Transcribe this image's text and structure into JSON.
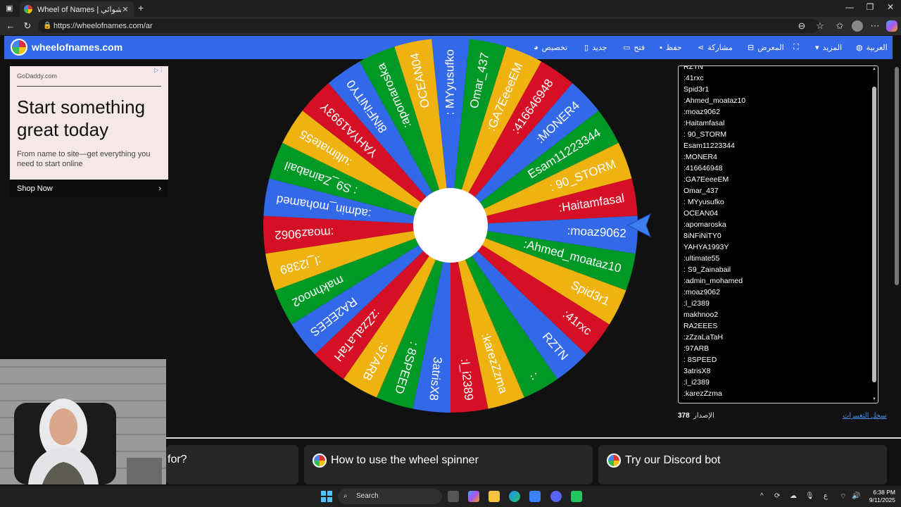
{
  "browser": {
    "tab_title": "Wheel of Names | الاسم العشوائي",
    "url": "https://wheelofnames.com/ar"
  },
  "site": {
    "brand": "wheelofnames.com",
    "menu": [
      {
        "label": "تخصيص",
        "icon": "palette-icon"
      },
      {
        "label": "جديد",
        "icon": "new-file-icon"
      },
      {
        "label": "فتح",
        "icon": "folder-icon"
      },
      {
        "label": "حفظ",
        "icon": "save-icon"
      },
      {
        "label": "مشاركة",
        "icon": "share-icon"
      },
      {
        "label": "المعرض",
        "icon": "gallery-icon"
      },
      {
        "label": "المزيد",
        "icon": "fullscreen-icon"
      },
      {
        "label": "العربية",
        "icon": "globe-icon"
      }
    ],
    "header_color": "#3369e8"
  },
  "ad": {
    "domain": "GoDaddy.com",
    "headline": "Start something great today",
    "subtext": "From name to site—get everything you need to start online",
    "cta": "Shop Now"
  },
  "wheel": {
    "colors": [
      "#3369e8",
      "#009925",
      "#eeb211",
      "#d50f25"
    ],
    "slices": [
      ": MYyusufko",
      "Omar_437",
      ":GA7EeeeEM",
      ":416646948",
      ":MONER4",
      "Esam11223344",
      ": 90_STORM",
      ":Haitamfasal",
      ":moaz9062",
      ":Ahmed_moataz10",
      "Spid3r1",
      ":41rxc",
      "RZTN",
      ":.",
      ":karezZzma",
      ":l_i2389",
      "3atrisX8",
      ": 8SPEED",
      ":97ARB",
      ":zZzaLaTaH",
      "RA2EEES",
      "makhnoo2",
      ":l_i2389",
      ":moaz9062",
      ":admin_mohamed",
      ": S9_Zainabail",
      ":ultimate55",
      "YAHYA1993Y",
      "8iNFiNiTY0",
      ":apomaroska",
      "OCEAN04"
    ]
  },
  "entries": [
    "RZTN",
    ":41rxc",
    "Spid3r1",
    ":Ahmed_moataz10",
    ":moaz9062",
    ":Haitamfasal",
    ": 90_STORM",
    "Esam11223344",
    ":MONER4",
    ":416646948",
    ":GA7EeeeEM",
    "Omar_437",
    ": MYyusufko",
    "OCEAN04",
    ":apomaroska",
    "8iNFiNiTY0",
    "YAHYA1993Y",
    ":ultimate55",
    ": S9_Zainabail",
    ":admin_mohamed",
    ":moaz9062",
    ":l_i2389",
    "makhnoo2",
    "RA2EEES",
    ":zZzaLaTaH",
    ":97ARB",
    ": 8SPEED",
    "3atrisX8",
    ":l_i2389",
    ":karezZzma"
  ],
  "version": {
    "label": "الإصدار",
    "number": "378"
  },
  "changelog_label": "سجل التغييرات",
  "cards": [
    {
      "title": "for?"
    },
    {
      "title": "How to use the wheel spinner"
    },
    {
      "title": "Try our Discord bot"
    }
  ],
  "taskbar": {
    "search": "Search",
    "time": "6:38 PM",
    "date": "9/11/2025",
    "lang": "ع"
  }
}
